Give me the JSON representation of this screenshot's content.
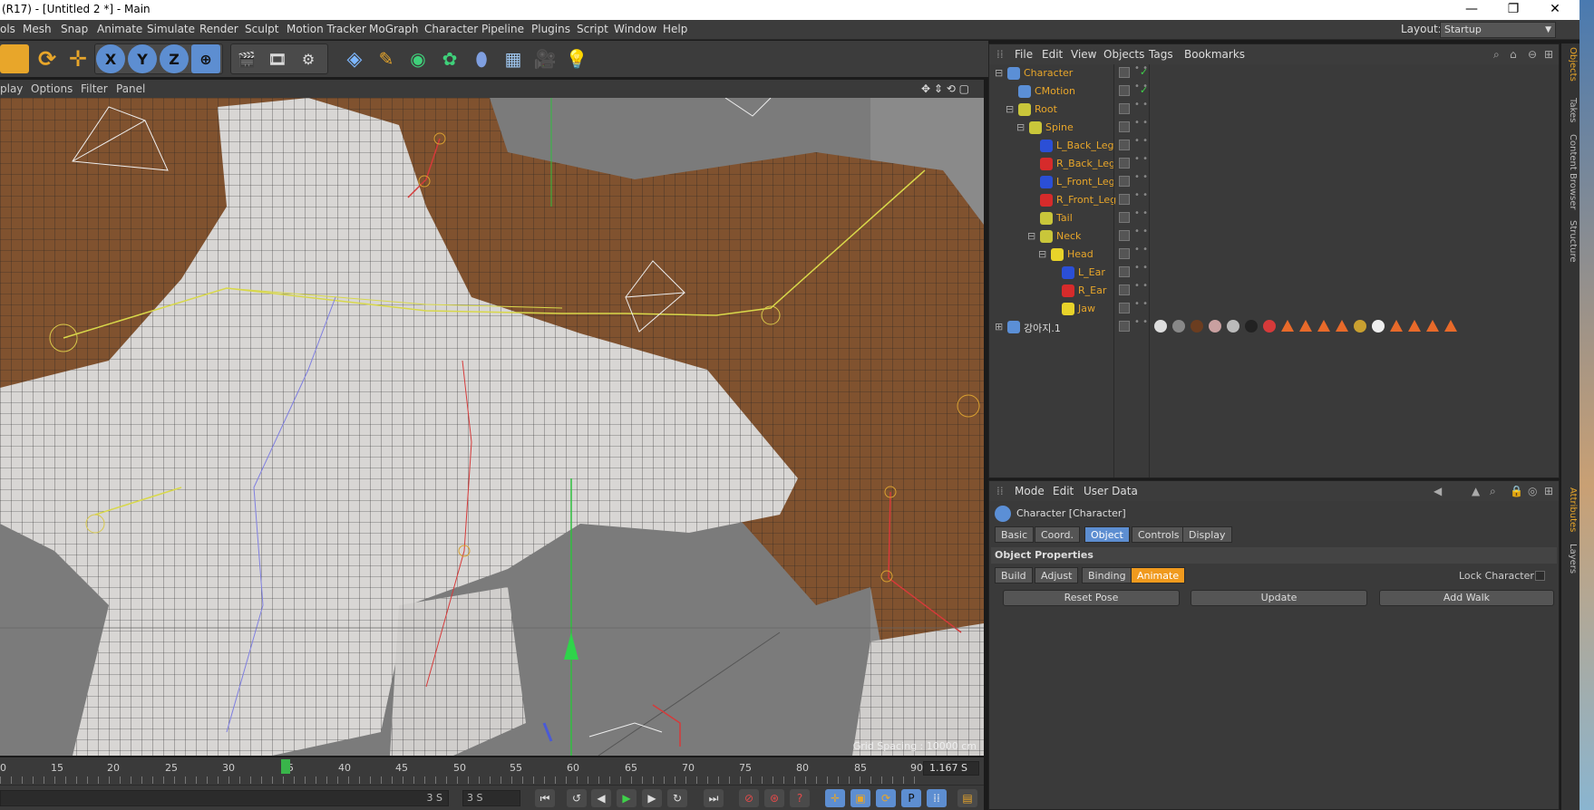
{
  "window": {
    "title": "(R17) - [Untitled 2 *] - Main",
    "buttons": {
      "minimize": "—",
      "restore": "❐",
      "close": "✕"
    }
  },
  "menubar": {
    "items": [
      "ols",
      "Mesh",
      "Snap",
      "Animate",
      "Simulate",
      "Render",
      "Sculpt",
      "Motion Tracker",
      "MoGraph",
      "Character",
      "Pipeline",
      "Plugins",
      "Script",
      "Window",
      "Help"
    ],
    "layout_label": "Layout:",
    "layout_value": "Startup"
  },
  "toolbar": {
    "axis_x": "X",
    "axis_y": "Y",
    "axis_z": "Z"
  },
  "viewport": {
    "menu": [
      "play",
      "Options",
      "Filter",
      "Panel"
    ],
    "grid_spacing": "Grid Spacing : 10000 cm"
  },
  "timeline": {
    "ticks": [
      "0",
      "15",
      "20",
      "25",
      "30",
      "35",
      "40",
      "45",
      "50",
      "55",
      "60",
      "65",
      "70",
      "75",
      "80",
      "85",
      "90"
    ],
    "current_frame": "1.167 S",
    "start_field": "3 S",
    "end_field": "3 S"
  },
  "object_manager": {
    "menu": [
      "File",
      "Edit",
      "View",
      "Objects",
      "Tags",
      "Bookmarks"
    ],
    "objects": [
      {
        "name": "Character",
        "color": "#e8a62a",
        "icon_color": "#5b8fd6",
        "depth": 0,
        "expand": "⊟"
      },
      {
        "name": "CMotion",
        "color": "#e8a62a",
        "icon_color": "#5b8fd6",
        "depth": 1,
        "expand": ""
      },
      {
        "name": "Root",
        "color": "#e8a62a",
        "icon_color": "#c9c63a",
        "depth": 1,
        "expand": "⊟"
      },
      {
        "name": "Spine",
        "color": "#e8a62a",
        "icon_color": "#c9c63a",
        "depth": 2,
        "expand": "⊟"
      },
      {
        "name": "L_Back_Leg",
        "color": "#e8a62a",
        "icon_color": "#2b4fd6",
        "depth": 3,
        "expand": ""
      },
      {
        "name": "R_Back_Leg",
        "color": "#e8a62a",
        "icon_color": "#d62b2b",
        "depth": 3,
        "expand": ""
      },
      {
        "name": "L_Front_Leg",
        "color": "#e8a62a",
        "icon_color": "#2b4fd6",
        "depth": 3,
        "expand": ""
      },
      {
        "name": "R_Front_Leg",
        "color": "#e8a62a",
        "icon_color": "#d62b2b",
        "depth": 3,
        "expand": ""
      },
      {
        "name": "Tail",
        "color": "#e8a62a",
        "icon_color": "#c9c63a",
        "depth": 3,
        "expand": ""
      },
      {
        "name": "Neck",
        "color": "#e8a62a",
        "icon_color": "#c9c63a",
        "depth": 3,
        "expand": "⊟"
      },
      {
        "name": "Head",
        "color": "#e8a62a",
        "icon_color": "#e8d32a",
        "depth": 4,
        "expand": "⊟"
      },
      {
        "name": "L_Ear",
        "color": "#e8a62a",
        "icon_color": "#2b4fd6",
        "depth": 5,
        "expand": ""
      },
      {
        "name": "R_Ear",
        "color": "#e8a62a",
        "icon_color": "#d62b2b",
        "depth": 5,
        "expand": ""
      },
      {
        "name": "Jaw",
        "color": "#e8a62a",
        "icon_color": "#e8d32a",
        "depth": 5,
        "expand": ""
      },
      {
        "name": "강아지.1",
        "color": "#dddddd",
        "icon_color": "#5b8fd6",
        "depth": 0,
        "expand": "⊞"
      }
    ]
  },
  "attribute_manager": {
    "menu": [
      "Mode",
      "Edit",
      "User Data"
    ],
    "object_title": "Character [Character]",
    "tabs": [
      "Basic",
      "Coord.",
      "Object",
      "Controls",
      "Display"
    ],
    "active_tab": "Object",
    "section": "Object Properties",
    "subtabs": [
      "Build",
      "Adjust",
      "Binding",
      "Animate"
    ],
    "active_subtab": "Animate",
    "lock_label": "Lock Character",
    "buttons": [
      "Reset Pose",
      "Update",
      "Add Walk"
    ]
  },
  "side_tabs": [
    "Objects",
    "Takes",
    "Content Browser",
    "Structure",
    "Attributes",
    "Layers"
  ]
}
